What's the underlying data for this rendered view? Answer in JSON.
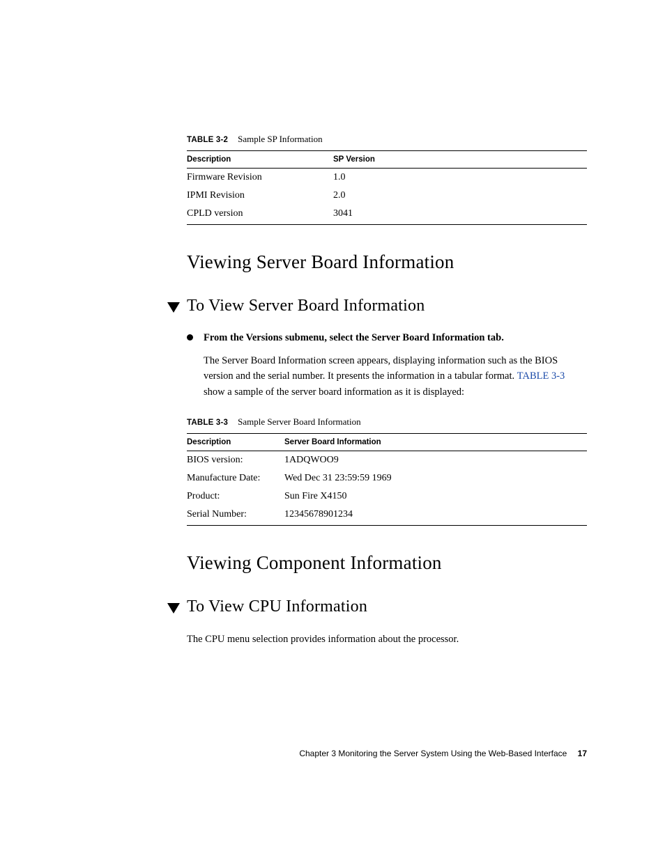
{
  "table32": {
    "caption_label": "TABLE 3-2",
    "caption_title": "Sample SP Information",
    "head_col1": "Description",
    "head_col2": "SP Version",
    "rows": [
      {
        "c1": "Firmware Revision",
        "c2": "1.0"
      },
      {
        "c1": "IPMI Revision",
        "c2": "2.0"
      },
      {
        "c1": "CPLD version",
        "c2": "3041"
      }
    ]
  },
  "h_server_board": "Viewing Server Board Information",
  "h_to_view_server_board": "To View Server Board Information",
  "step1_bold": "From the Versions submenu, select the Server Board Information tab.",
  "body1_a": "The Server Board Information screen appears, displaying information such as the BIOS version and the serial number. It presents the information in a tabular format. ",
  "body1_xref": "TABLE 3-3",
  "body1_b": " show a sample of the server board information as it is displayed:",
  "table33": {
    "caption_label": "TABLE 3-3",
    "caption_title": "Sample Server Board Information",
    "head_col1": "Description",
    "head_col2": "Server Board Information",
    "rows": [
      {
        "c1": "BIOS version:",
        "c2": "1ADQWOO9"
      },
      {
        "c1": "Manufacture Date:",
        "c2": "Wed Dec 31 23:59:59 1969"
      },
      {
        "c1": "Product:",
        "c2": "Sun Fire X4150"
      },
      {
        "c1": "Serial Number:",
        "c2": "12345678901234"
      }
    ]
  },
  "h_component": "Viewing Component Information",
  "h_to_view_cpu": "To View CPU Information",
  "cpu_body": "The CPU menu selection provides information about the processor.",
  "footer_text": "Chapter 3    Monitoring the Server System Using the Web-Based Interface",
  "footer_page": "17"
}
